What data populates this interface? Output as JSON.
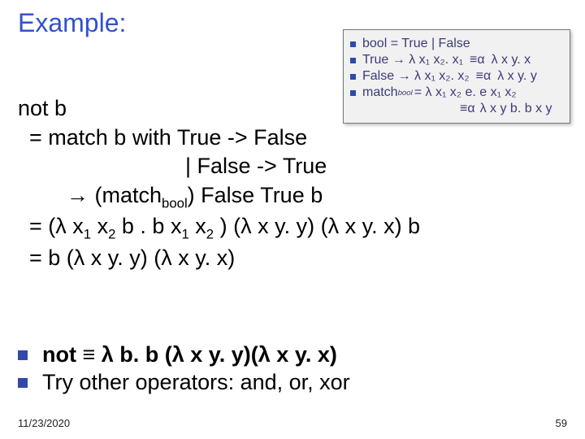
{
  "title": "Example:",
  "inset": {
    "line1": "bool = True | False",
    "line2_left": "True → λ x₁ x₂. x₁",
    "line2_right": "λ x y. x",
    "line3_left": "False → λ x₁ x₂. x₂",
    "line3_right": "λ x y. y",
    "line4_left": "match",
    "line4_sub": "bool",
    "line4_mid": "= λ x₁ x₂ e. e x₁ x₂",
    "line4_right": "λ x y b. b x y",
    "eqa": "≡α"
  },
  "body": {
    "l1": "not b",
    "l2": "= match b with True -> False",
    "l3": "| False -> True",
    "l4_pre": "→ (match",
    "l4_sub": "bool",
    "l4_post": ") False True b",
    "l5_a": "= (λ x",
    "l5_s1": "1",
    "l5_b": " x",
    "l5_s2": "2",
    "l5_c": " b . b x",
    "l5_s3": "1",
    "l5_d": " x",
    "l5_s4": "2",
    "l5_e": " ) (λ x y. y) (λ x y. x) b",
    "l6": "= b (λ x y. y) (λ x y. x)"
  },
  "bullets": {
    "b1": "not ≡ λ b. b (λ x y. y)(λ x y. x)",
    "b2": "Try other operators: and, or, xor"
  },
  "footer": {
    "date": "11/23/2020",
    "page": "59"
  }
}
